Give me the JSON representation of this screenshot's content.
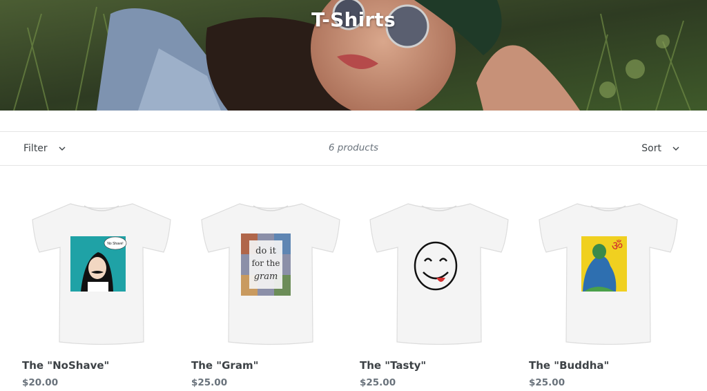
{
  "hero": {
    "title": "T-Shirts"
  },
  "toolbar": {
    "filter_label": "Filter",
    "product_count": "6 products",
    "sort_label": "Sort"
  },
  "products": [
    {
      "name": "The \"NoShave\"",
      "price": "$20.00",
      "print_text": "No Shave!"
    },
    {
      "name": "The \"Gram\"",
      "price": "$25.00",
      "print_line1": "do it",
      "print_line2": "for the",
      "print_line3": "gram"
    },
    {
      "name": "The \"Tasty\"",
      "price": "$25.00"
    },
    {
      "name": "The \"Buddha\"",
      "price": "$25.00"
    }
  ],
  "colors": {
    "text_primary": "#3d4246",
    "text_muted": "#69727b",
    "border": "#e4e4e4",
    "shirt": "#f4f4f4"
  }
}
